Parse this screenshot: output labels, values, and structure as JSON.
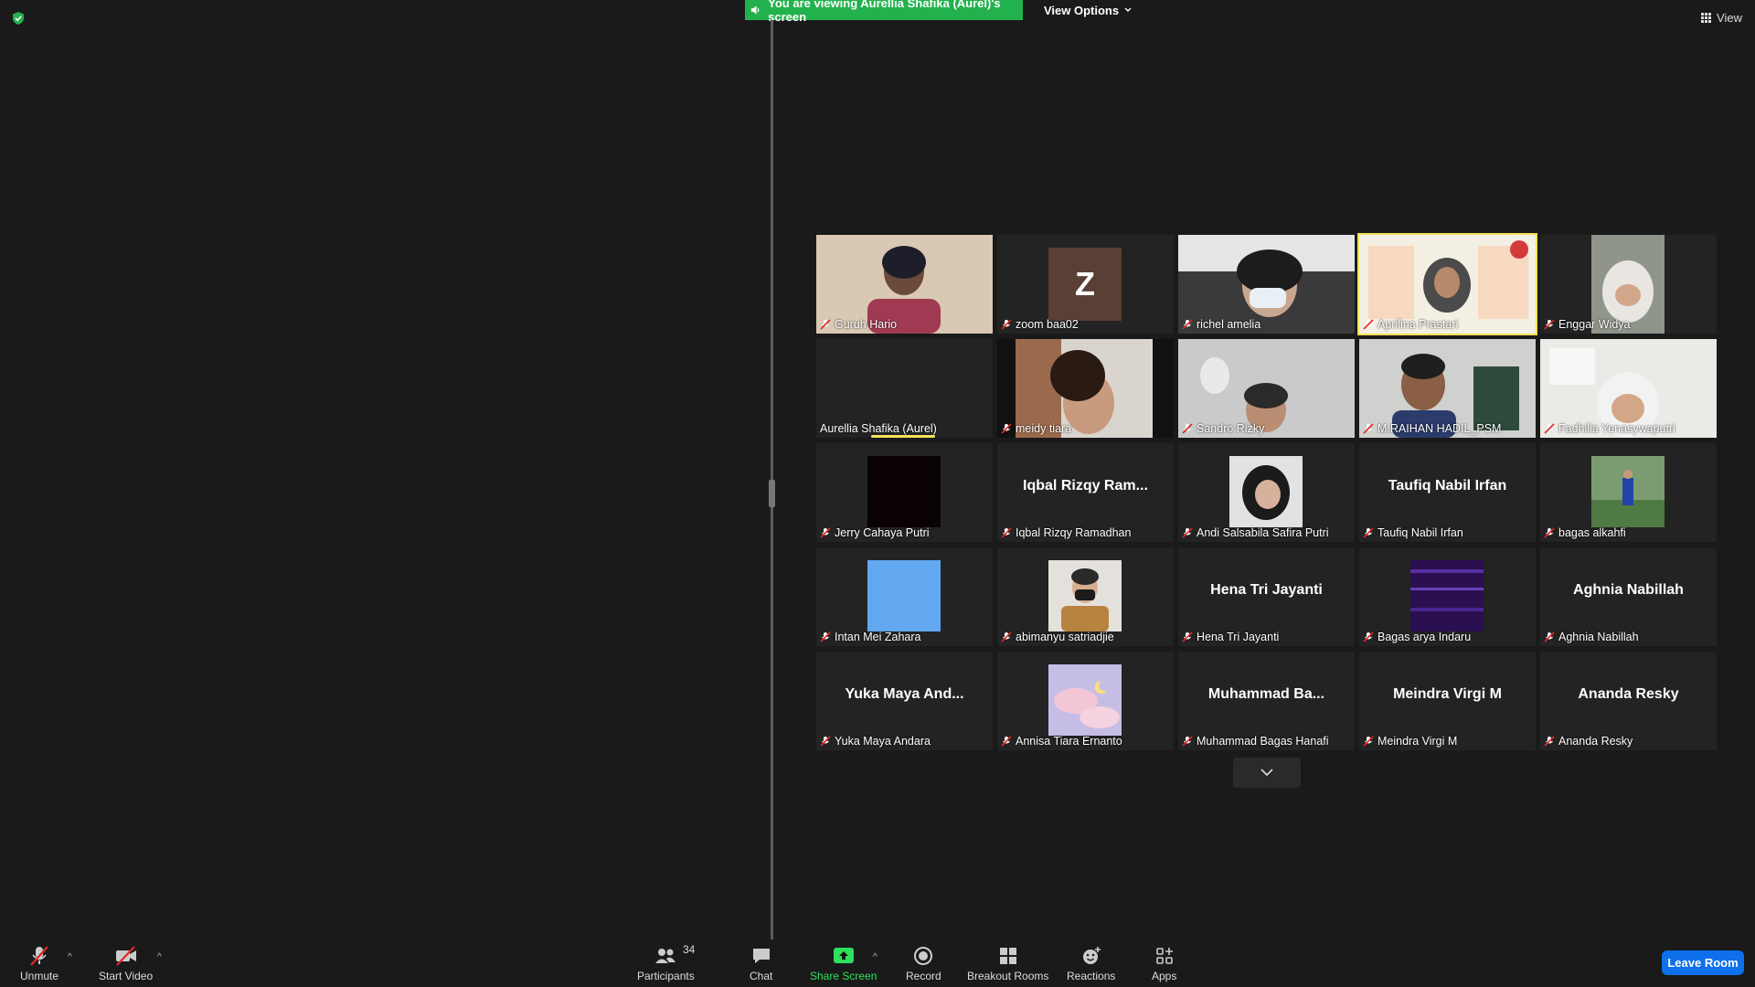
{
  "top": {
    "banner": "You are viewing Aurellia Shafika (Aurel)'s screen",
    "view_options": "View Options",
    "view": "View"
  },
  "tiles": [
    {
      "name": "Guruh Hario",
      "muted": true
    },
    {
      "name": "zoom baa02",
      "muted": true,
      "avatar": "Z"
    },
    {
      "name": "richel amelia",
      "muted": true
    },
    {
      "name": "Aprilina Prastari",
      "muted": true,
      "active": true
    },
    {
      "name": "Enggar Widya",
      "muted": true
    },
    {
      "name": "Aurellia Shafika (Aurel)",
      "muted": false,
      "speaking": true
    },
    {
      "name": "meidy tiara",
      "muted": true
    },
    {
      "name": "Sandro Rizky",
      "muted": true
    },
    {
      "name": "M.RAIHAN HADIL_PSM",
      "muted": true
    },
    {
      "name": "Fadhilla Yenasywaputri",
      "muted": true
    },
    {
      "name": "Jerry Cahaya Putri",
      "muted": true
    },
    {
      "name": "Iqbal Rizqy Ramadhan",
      "muted": true,
      "display": "Iqbal  Rizqy  Ram..."
    },
    {
      "name": "Andi Salsabila Safira Putri",
      "muted": true
    },
    {
      "name": "Taufiq Nabil Irfan",
      "muted": true,
      "display": "Taufiq Nabil Irfan"
    },
    {
      "name": "bagas alkahfi",
      "muted": true
    },
    {
      "name": "Intan Mei Zahara",
      "muted": true
    },
    {
      "name": "abimanyu satriadjie",
      "muted": true
    },
    {
      "name": "Hena Tri Jayanti",
      "muted": true,
      "display": "Hena Tri Jayanti"
    },
    {
      "name": "Bagas arya Indaru",
      "muted": true
    },
    {
      "name": "Aghnia Nabillah",
      "muted": true,
      "display": "Aghnia Nabillah"
    },
    {
      "name": "Yuka Maya Andara",
      "muted": true,
      "display": "Yuka  Maya  And..."
    },
    {
      "name": "Annisa Tiara Ernanto",
      "muted": true
    },
    {
      "name": "Muhammad Bagas Hanafi",
      "muted": true,
      "display": "Muhammad  Ba..."
    },
    {
      "name": "Meindra Virgi M",
      "muted": true,
      "display": "Meindra Virgi M"
    },
    {
      "name": "Ananda Resky",
      "muted": true,
      "display": "Ananda Resky"
    }
  ],
  "toolbar": {
    "unmute": "Unmute",
    "start_video": "Start Video",
    "participants": "Participants",
    "participants_count": "34",
    "chat": "Chat",
    "share_screen": "Share Screen",
    "record": "Record",
    "breakout_rooms": "Breakout Rooms",
    "reactions": "Reactions",
    "apps": "Apps",
    "leave_room": "Leave Room"
  },
  "colors": {
    "banner_green": "#23b14d",
    "active_border": "#f4e15a",
    "leave_blue": "#0e71eb",
    "mute_red": "#e02828"
  }
}
